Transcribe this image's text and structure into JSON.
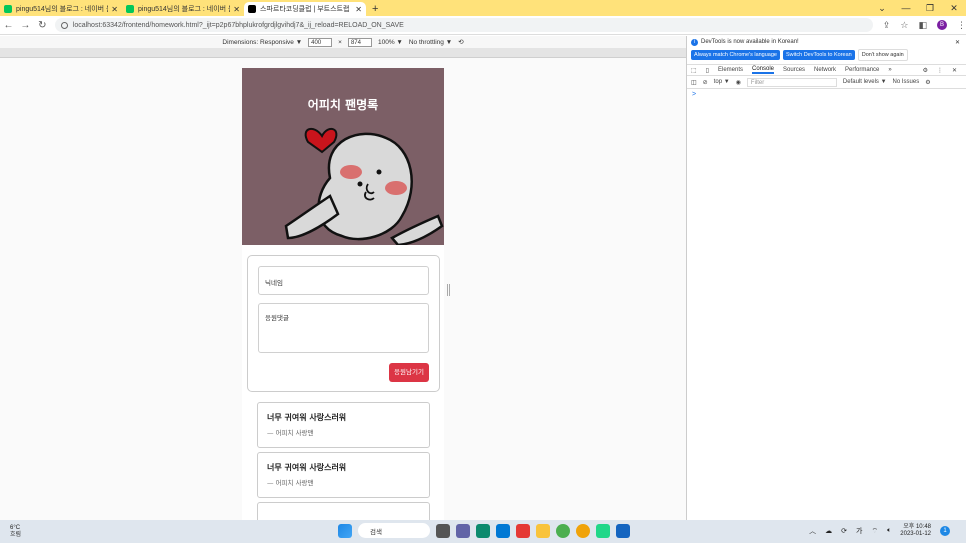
{
  "browser": {
    "tabs": [
      {
        "title": "pingu514님의 블로그 : 네이버 블",
        "favicon_color": "#03c75a",
        "active": false
      },
      {
        "title": "pingu514님의 블로그 : 네이버 블",
        "favicon_color": "#03c75a",
        "active": false
      },
      {
        "title": "스파르타코딩클럽 | 부트스트랩",
        "favicon_color": "#000000",
        "active": true
      }
    ],
    "new_tab": "+",
    "url": "localhost:63342/frontend/homework.html?_ijt=p2p67bhplukrofgrdjlgvihdj7&_ij_reload=RELOAD_ON_SAVE",
    "profile_initial": "B"
  },
  "device_toolbar": {
    "dimensions_label": "Dimensions: Responsive ▼",
    "width": "400",
    "times": "×",
    "height": "874",
    "zoom": "100% ▼",
    "throttle": "No throttling ▼"
  },
  "page": {
    "hero_title": "어피치 팬명록",
    "nickname_placeholder": "닉네임",
    "comment_placeholder": "응원댓글",
    "submit_label": "응원남기기",
    "comments": [
      {
        "message": "너무 귀여워 사랑스러워",
        "author": "— 어피치 사랑맨"
      },
      {
        "message": "너무 귀여워 사랑스러워",
        "author": "— 어피치 사랑맨"
      }
    ],
    "hero_color": "#7c5f66",
    "button_color": "#dc3545"
  },
  "devtools": {
    "info_text": "DevTools is now available in Korean!",
    "btn_match": "Always match Chrome's language",
    "btn_switch": "Switch DevTools to Korean",
    "btn_dismiss": "Don't show again",
    "tabs": [
      "Elements",
      "Console",
      "Sources",
      "Network",
      "Performance",
      "»"
    ],
    "context": "top ▼",
    "filter_placeholder": "Filter",
    "levels": "Default levels ▼",
    "issues": "No Issues",
    "prompt": ">"
  },
  "taskbar": {
    "temp": "6°C",
    "weather": "흐림",
    "search": "검색",
    "ime": "가",
    "ampm_time": "오후 10:48",
    "date": "2023-01-12",
    "notif": "1"
  }
}
